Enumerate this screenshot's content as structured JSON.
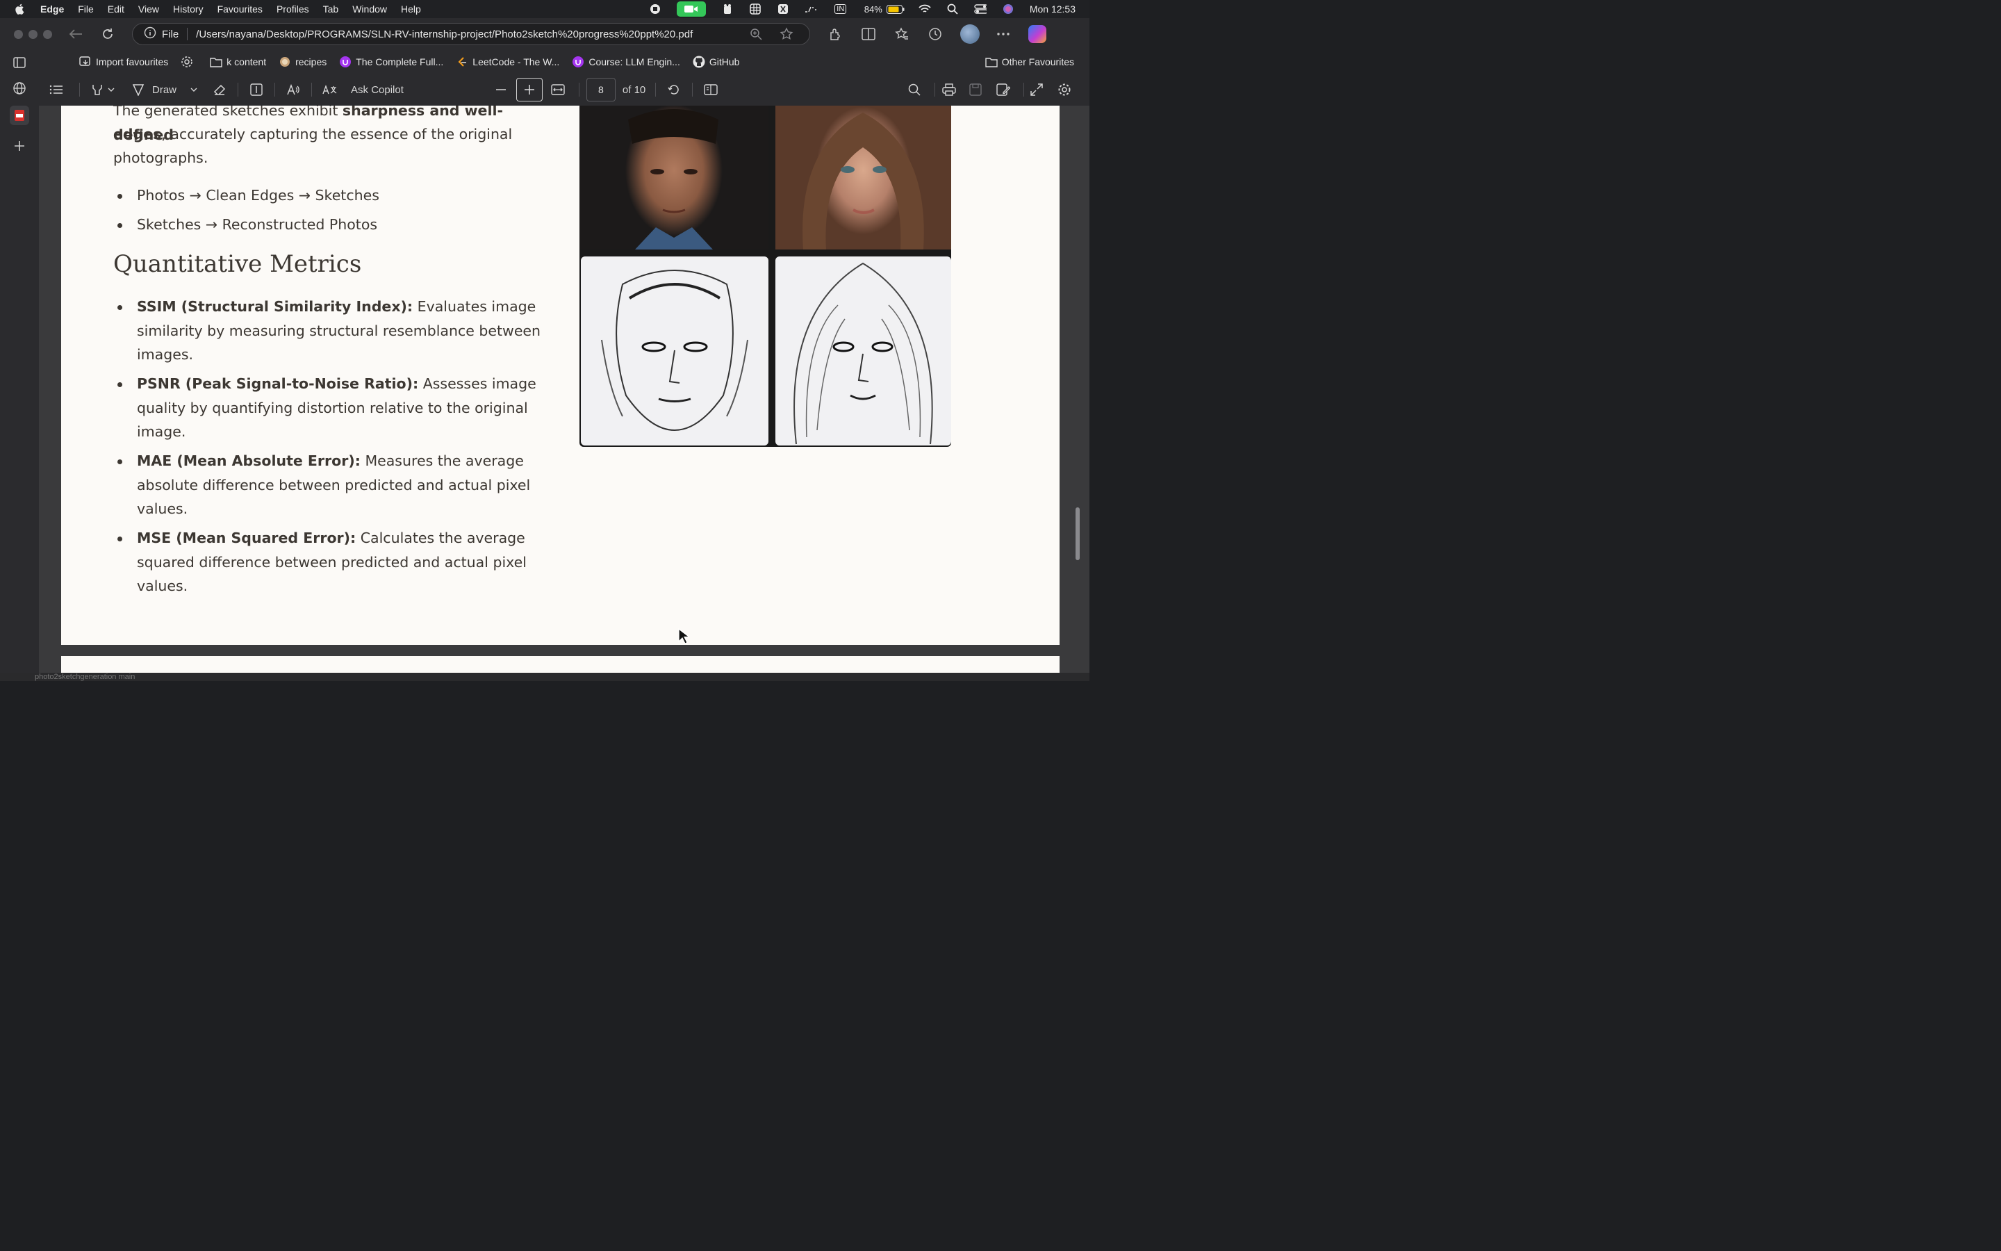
{
  "menubar": {
    "app": "Edge",
    "items": [
      "File",
      "Edit",
      "View",
      "History",
      "Favourites",
      "Profiles",
      "Tab",
      "Window",
      "Help"
    ],
    "battery": "84%",
    "input_source": "IN",
    "clock": "Mon 12:53"
  },
  "toolbar": {
    "address_prefix": "File",
    "url": "/Users/nayana/Desktop/PROGRAMS/SLN-RV-internship-project/Photo2sketch%20progress%20ppt%20.pdf"
  },
  "favourites": {
    "items": [
      {
        "label": "Import favourites",
        "icon": "import-icon"
      },
      {
        "label": "k content",
        "icon": "folder-icon"
      },
      {
        "label": "recipes",
        "icon": "recipe-icon"
      },
      {
        "label": "The Complete Full...",
        "icon": "udemy-icon"
      },
      {
        "label": "LeetCode - The W...",
        "icon": "leetcode-icon"
      },
      {
        "label": "Course: LLM Engin...",
        "icon": "udemy-icon"
      },
      {
        "label": "GitHub",
        "icon": "github-icon"
      }
    ],
    "other": "Other Favourites"
  },
  "pdf_toolbar": {
    "draw_label": "Draw",
    "ask_copilot": "Ask Copilot",
    "page_number": "8",
    "page_total": "of 10"
  },
  "document": {
    "intro_line1_prefix": "The generated sketches exhibit ",
    "intro_line1_bold": "sharpness and well-defined",
    "intro_line2_bold": "edges",
    "intro_line2_rest": ", accurately capturing the essence of the original",
    "intro_line3": "photographs.",
    "flow_bullets": [
      "Photos → Clean Edges → Sketches",
      "Sketches → Reconstructed Photos"
    ],
    "metrics_heading": "Quantitative Metrics",
    "metrics": [
      {
        "label": "SSIM (Structural Similarity Index):",
        "line1": " Evaluates image",
        "line2": "similarity by measuring structural resemblance between",
        "line3": "images."
      },
      {
        "label": "PSNR (Peak Signal-to-Noise Ratio):",
        "line1": " Assesses image",
        "line2": "quality by quantifying distortion relative to the original",
        "line3": "image."
      },
      {
        "label": "MAE (Mean Absolute Error):",
        "line1": " Measures the average",
        "line2": "absolute difference between predicted and actual pixel",
        "line3": "values."
      },
      {
        "label": "MSE (Mean Squared Error):",
        "line1": " Calculates the average",
        "line2": "squared difference between predicted and actual pixel",
        "line3": "values."
      }
    ]
  },
  "bottom_status": "photo2sketchgeneration  main"
}
